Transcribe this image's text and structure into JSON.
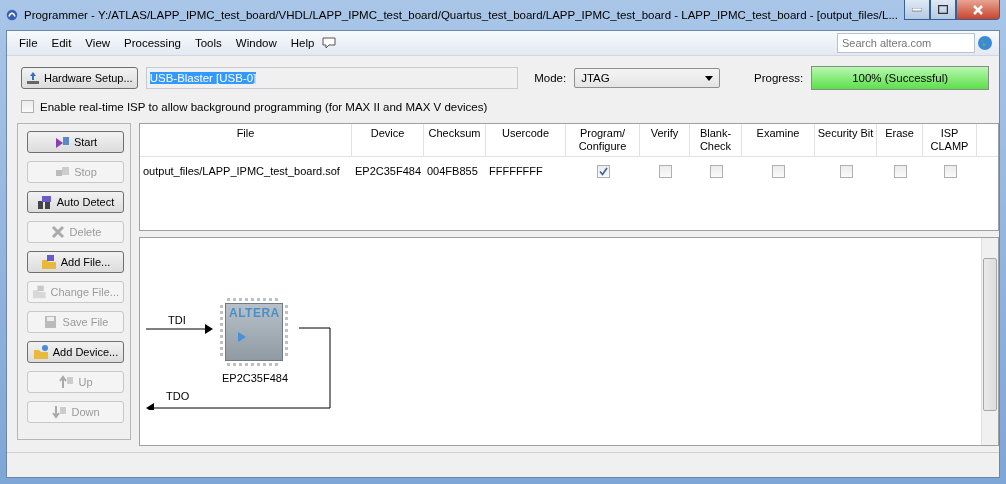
{
  "window": {
    "title": "Programmer - Y:/ATLAS/LAPP_IPMC_test_board/VHDL/LAPP_IPMC_test_board/Quartus_test_board/LAPP_IPMC_test_board - LAPP_IPMC_test_board - [output_files/L..."
  },
  "menu": [
    "File",
    "Edit",
    "View",
    "Processing",
    "Tools",
    "Window",
    "Help"
  ],
  "search": {
    "placeholder": "Search altera.com"
  },
  "toolbar": {
    "hardware_button": "Hardware Setup...",
    "hardware_value": "USB-Blaster [USB-0]",
    "mode_label": "Mode:",
    "mode_value": "JTAG",
    "progress_label": "Progress:",
    "progress": {
      "level": 1,
      "text": "100% (Successful)"
    }
  },
  "realtime_isp": {
    "label": "Enable real-time ISP to allow background programming (for MAX II and MAX V devices)",
    "checked": false
  },
  "buttons": [
    {
      "label": "Start",
      "disabled": false
    },
    {
      "label": "Stop",
      "disabled": true
    },
    {
      "label": "Auto Detect",
      "disabled": false
    },
    {
      "label": "Delete",
      "disabled": true
    },
    {
      "label": "Add File...",
      "disabled": false
    },
    {
      "label": "Change File...",
      "disabled": true
    },
    {
      "label": "Save File",
      "disabled": true
    },
    {
      "label": "Add Device...",
      "disabled": false
    },
    {
      "label": "Up",
      "disabled": true
    },
    {
      "label": "Down",
      "disabled": true
    }
  ],
  "table": {
    "columns": [
      "File",
      "Device",
      "Checksum",
      "Usercode",
      "Program/ Configure",
      "Verify",
      "Blank- Check",
      "Examine",
      "Security Bit",
      "Erase",
      "ISP CLAMP"
    ],
    "rows": [
      {
        "cells": [
          {
            "kind": "text",
            "text": "output_files/LAPP_IPMC_test_board.sof"
          },
          {
            "kind": "text",
            "text": "EP2C35F484"
          },
          {
            "kind": "text",
            "text": "004FB855"
          },
          {
            "kind": "text",
            "text": "FFFFFFFF"
          },
          {
            "kind": "check",
            "checked": true
          },
          {
            "kind": "check",
            "checked": false
          },
          {
            "kind": "check",
            "checked": false
          },
          {
            "kind": "check",
            "checked": false
          },
          {
            "kind": "check",
            "checked": false
          },
          {
            "kind": "check",
            "checked": false
          },
          {
            "kind": "check",
            "checked": false
          }
        ]
      }
    ]
  },
  "diagram": {
    "input": "TDI",
    "output": "TDO",
    "chip_logo": "ALTERA",
    "device": "EP2C35F484"
  }
}
